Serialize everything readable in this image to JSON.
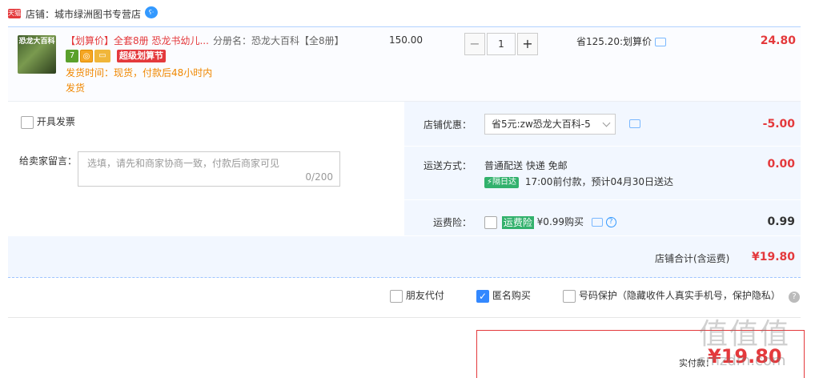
{
  "shop": {
    "badge": "天猫",
    "label": "店铺：城市绿洲图书专营店",
    "chat": "ʕ·"
  },
  "item": {
    "thumb_text": "恐龙大百科",
    "title": "【划算价】全套8册 恐龙书幼儿...",
    "sku": "分册名：恐龙大百科【全8册】",
    "tags": {
      "t1": "7",
      "t2": "◎",
      "t3": "▭",
      "promo": "超级划算节"
    },
    "ship_time": "发货时间：现货，付款后48小时内发货",
    "price": "150.00",
    "qty": {
      "minus": "−",
      "value": "1",
      "plus": "+"
    },
    "save": "省125.20:划算价",
    "subtotal": "24.80"
  },
  "invoice": {
    "label": "开具发票"
  },
  "message": {
    "label": "给卖家留言：",
    "placeholder": "选填，请先和商家协商一致，付款后商家可见",
    "counter": "0/200"
  },
  "discount": {
    "label": "店铺优惠：",
    "selected": "省5元:zw恐龙大百科-5",
    "amount": "-5.00"
  },
  "shipping": {
    "label": "运送方式：",
    "method": "普通配送 快递 免邮",
    "badge": "⚡隔日达",
    "eta": "17:00前付款，预计04月30日送达",
    "amount": "0.00"
  },
  "insurance": {
    "label": "运费险：",
    "badge": "运费险",
    "text": "¥0.99购买",
    "help": "?",
    "amount": "0.99"
  },
  "total": {
    "label": "店铺合计(含运费)",
    "value": "¥19.80"
  },
  "options": {
    "friend_pay": "朋友代付",
    "anonymous": "匿名购买",
    "number_protect": "号码保护（隐藏收件人真实手机号，保护隐私）",
    "help": "?"
  },
  "pay": {
    "label": "实付款：",
    "value": "¥19.80"
  },
  "watermark": {
    "logo": "值值值",
    "site": "smzdm.com"
  }
}
